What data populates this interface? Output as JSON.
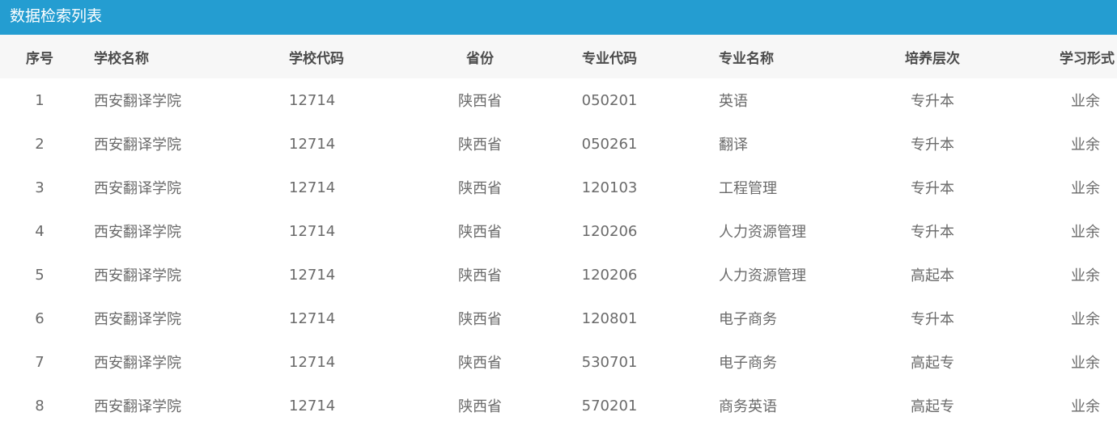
{
  "panel": {
    "title": "数据检索列表"
  },
  "table": {
    "columns": [
      "序号",
      "学校名称",
      "学校代码",
      "省份",
      "专业代码",
      "专业名称",
      "培养层次",
      "学习形式"
    ],
    "rows": [
      [
        "1",
        "西安翻译学院",
        "12714",
        "陕西省",
        "050201",
        "英语",
        "专升本",
        "业余"
      ],
      [
        "2",
        "西安翻译学院",
        "12714",
        "陕西省",
        "050261",
        "翻译",
        "专升本",
        "业余"
      ],
      [
        "3",
        "西安翻译学院",
        "12714",
        "陕西省",
        "120103",
        "工程管理",
        "专升本",
        "业余"
      ],
      [
        "4",
        "西安翻译学院",
        "12714",
        "陕西省",
        "120206",
        "人力资源管理",
        "专升本",
        "业余"
      ],
      [
        "5",
        "西安翻译学院",
        "12714",
        "陕西省",
        "120206",
        "人力资源管理",
        "高起本",
        "业余"
      ],
      [
        "6",
        "西安翻译学院",
        "12714",
        "陕西省",
        "120801",
        "电子商务",
        "专升本",
        "业余"
      ],
      [
        "7",
        "西安翻译学院",
        "12714",
        "陕西省",
        "530701",
        "电子商务",
        "高起专",
        "业余"
      ],
      [
        "8",
        "西安翻译学院",
        "12714",
        "陕西省",
        "570201",
        "商务英语",
        "高起专",
        "业余"
      ]
    ]
  },
  "colors": {
    "header_bar": "#249dd1",
    "column_header_bg": "#f7f7f7",
    "column_header_text": "#4c4c4c",
    "cell_text": "#6a6a6a"
  }
}
